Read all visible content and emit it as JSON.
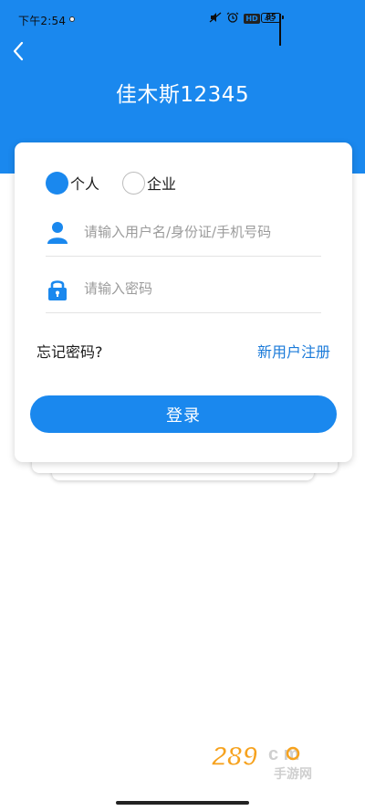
{
  "status_bar": {
    "time": "下午2:54",
    "hd_badge": "HD",
    "network": "4G",
    "battery": "85"
  },
  "header": {
    "title": "佳木斯12345"
  },
  "login": {
    "account_types": [
      {
        "label": "个人",
        "checked": true
      },
      {
        "label": "企业",
        "checked": false
      }
    ],
    "username": {
      "placeholder": "请输入用户名/身份证/手机号码",
      "value": ""
    },
    "password": {
      "placeholder": "请输入密码",
      "value": ""
    },
    "forgot_label": "忘记密码?",
    "register_label": "新用户注册",
    "submit_label": "登录"
  },
  "watermark": {
    "brand": "289",
    "suffix": "c m",
    "subtitle": "手游网"
  },
  "colors": {
    "primary": "#1a88ee",
    "link": "#1a7ad9",
    "placeholder": "#9b9b9b"
  },
  "icons": {
    "back": "chevron-left-icon",
    "user": "user-icon",
    "lock": "lock-icon",
    "alarm": "alarm-icon",
    "mute": "mute-icon"
  }
}
